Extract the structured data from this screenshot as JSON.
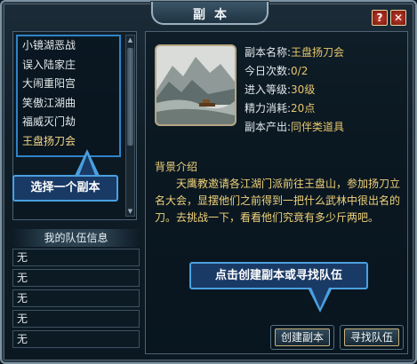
{
  "window": {
    "title": "副本",
    "help_label": "?",
    "close_label": "✕"
  },
  "dungeons": [
    {
      "name": "小镜湖恶战",
      "selected": false
    },
    {
      "name": "误入陆家庄",
      "selected": false
    },
    {
      "name": "大闹重阳宫",
      "selected": false
    },
    {
      "name": "笑傲江湖曲",
      "selected": false
    },
    {
      "name": "福威灭门劫",
      "selected": false
    },
    {
      "name": "王盘扬刀会",
      "selected": true
    }
  ],
  "tips": {
    "select": "选择一个副本",
    "create": "点击创建副本或寻找队伍"
  },
  "team": {
    "header": "我的队伍信息",
    "slots": [
      "无",
      "无",
      "无",
      "无",
      "无"
    ]
  },
  "details": {
    "name_label": "副本名称:",
    "name_value": "王盘扬刀会",
    "count_label": "今日次数:",
    "count_value": "0/2",
    "level_label": "进入等级:",
    "level_value": "30级",
    "energy_label": "精力消耗:",
    "energy_value": "20点",
    "output_label": "副本产出:",
    "output_value": "同伴类道具"
  },
  "background": {
    "title": "背景介绍",
    "text": "天鹰教邀请各江湖门派前往王盘山，参加扬刀立名大会，显摆他们之前得到一把什么武林中很出名的刀。去挑战一下，看看他们究竟有多少斤两吧。"
  },
  "buttons": {
    "create": "创建副本",
    "find": "寻找队伍"
  },
  "colors": {
    "accent": "#4aa0e0",
    "value": "#e6c66d",
    "lore": "#f0d27a"
  }
}
